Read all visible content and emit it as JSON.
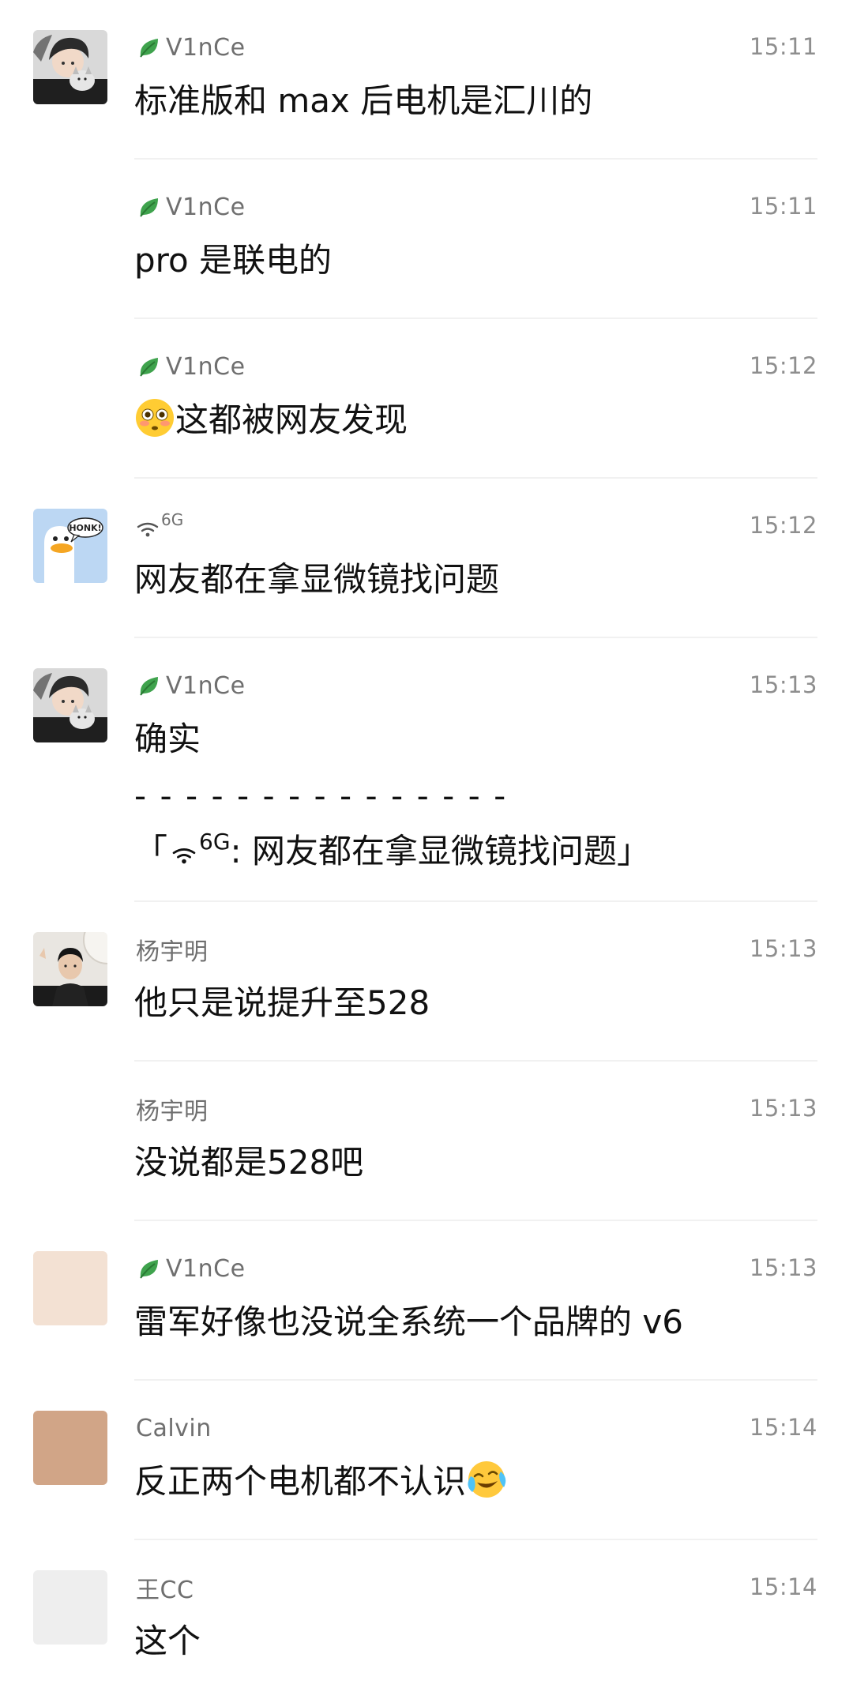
{
  "colors": {
    "background": "#ffffff",
    "name_text": "#6f6f6f",
    "time_text": "#8e8e8e",
    "message_text": "#111111",
    "leaf_green": "#3fa34d"
  },
  "messages": [
    {
      "sender": "V1nCe",
      "sender_icon": "leaf-icon",
      "time": "15:11",
      "text": "标准版和 max 后电机是汇川的",
      "avatar": "avatar-boy-with-cat"
    },
    {
      "sender": "V1nCe",
      "sender_icon": "leaf-icon",
      "time": "15:11",
      "text": "pro 是联电的",
      "avatar": null
    },
    {
      "sender": "V1nCe",
      "sender_icon": "leaf-icon",
      "time": "15:12",
      "emoji": "flushed-face-emoji",
      "text": "这都被网友发现",
      "avatar": null
    },
    {
      "sender": "",
      "sender_sup": "6G",
      "sender_icon": "wifi-icon",
      "time": "15:12",
      "text": "网友都在拿显微镜找问题",
      "avatar": "avatar-honk-goose"
    },
    {
      "sender": "V1nCe",
      "sender_icon": "leaf-icon",
      "time": "15:13",
      "text": "确实",
      "avatar": "avatar-boy-with-cat",
      "quote_separator": "- - - - - - - - - - - - - - -",
      "quote": {
        "open": "「",
        "sup": "6G",
        "body": ": 网友都在拿显微镜找问题",
        "close": "」"
      }
    },
    {
      "sender": "杨宇明",
      "time": "15:13",
      "text": "他只是说提升至528",
      "avatar": "avatar-man-photo"
    },
    {
      "sender": "杨宇明",
      "time": "15:13",
      "text": "没说都是528吧",
      "avatar": null
    },
    {
      "sender": "V1nCe",
      "sender_icon": "leaf-icon",
      "time": "15:13",
      "text": "雷军好像也没说全系统一个品牌的 v6",
      "avatar": "avatar-beige-blank"
    },
    {
      "sender": "Calvin",
      "time": "15:14",
      "text": "反正两个电机都不认识",
      "emoji": "crying-laughing-emoji",
      "avatar": "avatar-tan-blank"
    },
    {
      "sender": "王CC",
      "time": "15:14",
      "text": "这个",
      "avatar": "avatar-grey-blank"
    }
  ]
}
